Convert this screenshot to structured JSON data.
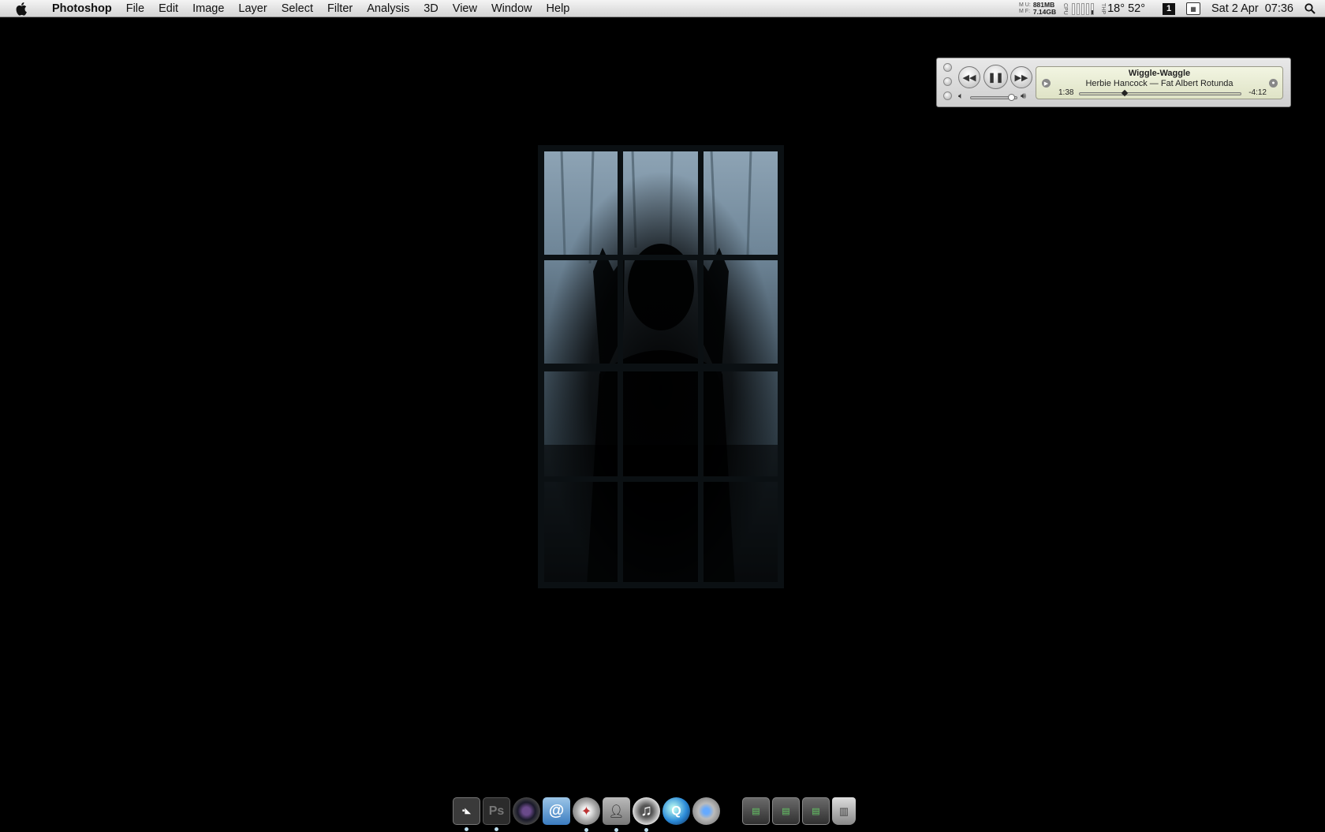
{
  "menubar": {
    "app_name": "Photoshop",
    "items": [
      "File",
      "Edit",
      "Image",
      "Layer",
      "Select",
      "Filter",
      "Analysis",
      "3D",
      "View",
      "Window",
      "Help"
    ],
    "memory_used": "881MB",
    "memory_free": "7.14GB",
    "temperature": "18° 52°",
    "spaces_number": "1",
    "datetime": "Sat 2 Apr  07:36"
  },
  "player": {
    "title": "Wiggle-Waggle",
    "subtitle": "Herbie Hancock — Fat Albert Rotunda",
    "elapsed": "1:38",
    "remaining": "-4:12",
    "progress_fraction": 0.28,
    "volume_fraction": 0.9
  },
  "dock": {
    "apps": [
      {
        "name": "finder-icon"
      },
      {
        "name": "photoshop-icon",
        "label": "Ps"
      },
      {
        "name": "aperture-icon"
      },
      {
        "name": "mail-icon"
      },
      {
        "name": "safari-icon"
      },
      {
        "name": "address-book-icon"
      },
      {
        "name": "itunes-icon"
      },
      {
        "name": "quicktime-icon"
      },
      {
        "name": "system-preferences-icon"
      }
    ],
    "stacks": [
      {
        "name": "documents-stack-icon"
      },
      {
        "name": "downloads-stack-icon"
      },
      {
        "name": "applications-stack-icon"
      },
      {
        "name": "trash-icon"
      }
    ]
  },
  "colors": {
    "desktop_bg": "#000000",
    "menubar_bg": "#e6e6e6",
    "lcd_bg": "#eceed8"
  }
}
